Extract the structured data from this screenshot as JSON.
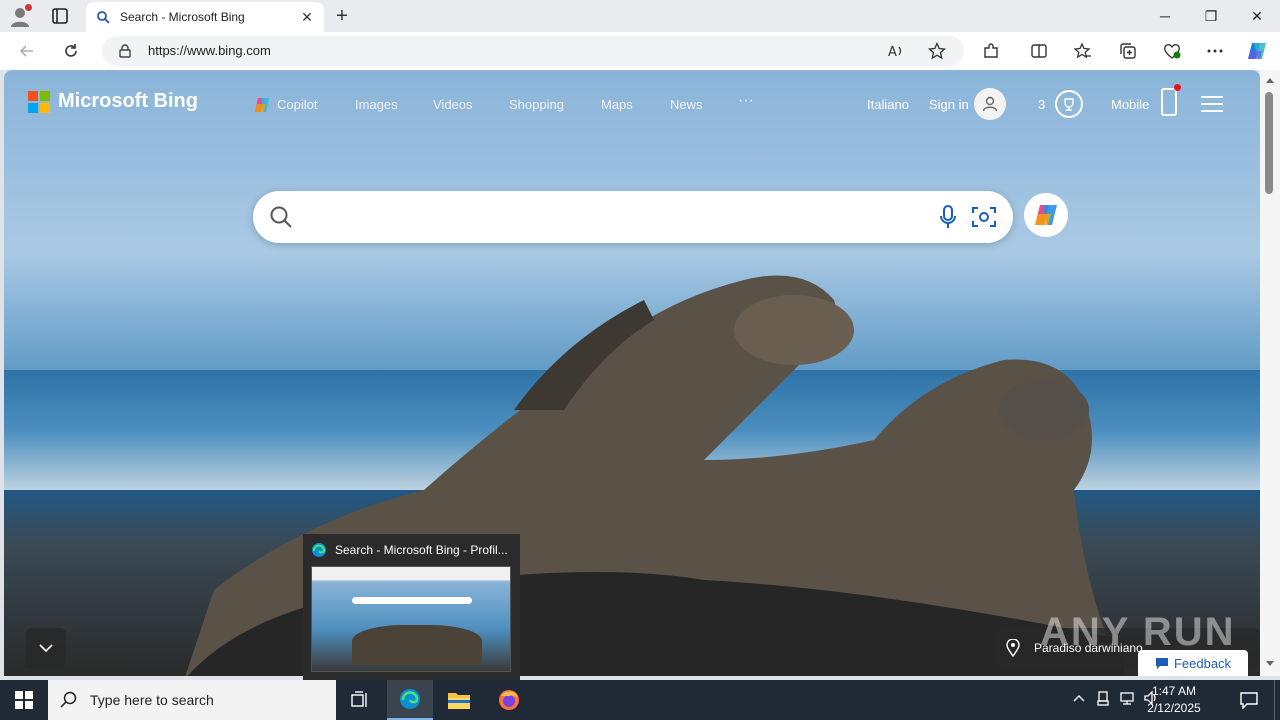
{
  "browser": {
    "tab_title": "Search - Microsoft Bing",
    "new_tab": "+",
    "url": "https://www.bing.com",
    "window_controls": {
      "minimize": "─",
      "restore": "❐",
      "close": "✕"
    }
  },
  "bing": {
    "logo_text": "Microsoft Bing",
    "nav": [
      "Copilot",
      "Images",
      "Videos",
      "Shopping",
      "Maps",
      "News",
      "···"
    ],
    "language": "Italiano",
    "sign_in": "Sign in",
    "rewards_count": "3",
    "mobile": "Mobile",
    "location_label": "Paradiso darwiniano",
    "feedback": "Feedback"
  },
  "watermark": "ANY RUN",
  "preview": {
    "title": "Search - Microsoft Bing - Profil..."
  },
  "taskbar": {
    "search_placeholder": "Type here to search",
    "time": "1:47 AM",
    "date": "2/12/2025"
  },
  "colors": {
    "accent": "#0078d4",
    "ms_red": "#f25022",
    "ms_green": "#7fba00",
    "ms_blue": "#00a4ef",
    "ms_yellow": "#ffb900",
    "taskbar_bg": "#1f2a36"
  }
}
